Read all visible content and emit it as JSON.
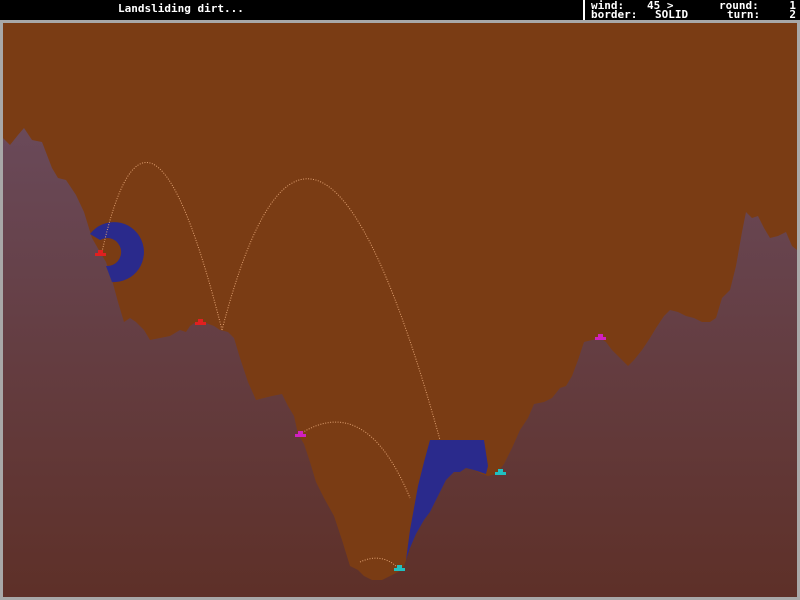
{
  "status": {
    "message": "Landsliding dirt...",
    "wind_label": "wind:",
    "wind_value": "45 >",
    "border_label": "border:",
    "border_value": "SOLID",
    "round_label": "round:",
    "round_value": "1",
    "turn_label": "turn:",
    "turn_value": "2"
  },
  "colors": {
    "sky": "#7a3c14",
    "dirt_top": "#6a4a5a",
    "dirt_bottom": "#5e3028",
    "shield": "#2a2a8c",
    "trail": "#e0a070",
    "frame": "#a8a8a8"
  },
  "tanks": [
    {
      "name": "red-tank-1",
      "color": "#e02020"
    },
    {
      "name": "red-tank-2",
      "color": "#e02020"
    },
    {
      "name": "magenta-tank-1",
      "color": "#d020c0"
    },
    {
      "name": "magenta-tank-2",
      "color": "#d020c0"
    },
    {
      "name": "cyan-tank-1",
      "color": "#20c0c0"
    },
    {
      "name": "cyan-tank-2",
      "color": "#20c0c0"
    }
  ]
}
